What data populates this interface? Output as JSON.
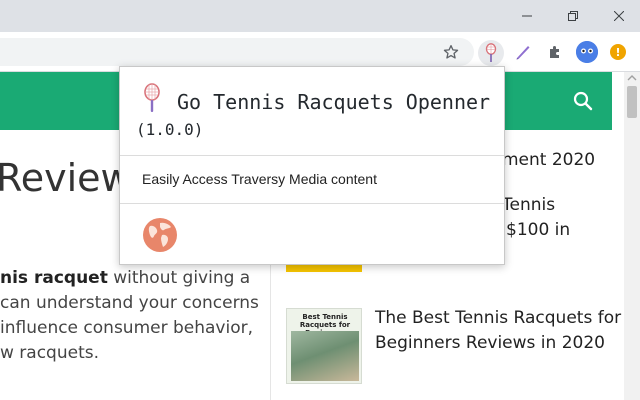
{
  "browser": {
    "window_controls": {
      "minimize": "minimize",
      "maximize": "restore",
      "close": "close"
    },
    "toolbar": {
      "extensions": [
        "tennis-racquet-icon",
        "pen-icon",
        "puzzle-icon"
      ],
      "update_badge": "!"
    }
  },
  "page": {
    "article": {
      "title": "Reviews",
      "body": {
        "line1_bold": "nis racquet",
        "line1_rest": " without giving a",
        "line2": "can understand your concerns",
        "line3": "influence consumer behavior,",
        "line4": "w racquets."
      }
    },
    "sidebar": {
      "item1_tail": "ment 2020",
      "item2_line1": "Tennis",
      "item2_line2": "$100 in",
      "item3_line1": "The Best Tennis Racquets for",
      "item3_line2": "Beginners Reviews in 2020",
      "item3_thumb_title": "Best Tennis Racquets for Beginners"
    }
  },
  "popup": {
    "title": "Go Tennis Racquets Openner",
    "version": "(1.0.0)",
    "link_label": "Easily Access Traversy Media content"
  },
  "colors": {
    "header_green": "#1aaa74",
    "globe": "#e8866a",
    "update_badge": "#f0a400",
    "avatar": "#4a7ee6"
  }
}
